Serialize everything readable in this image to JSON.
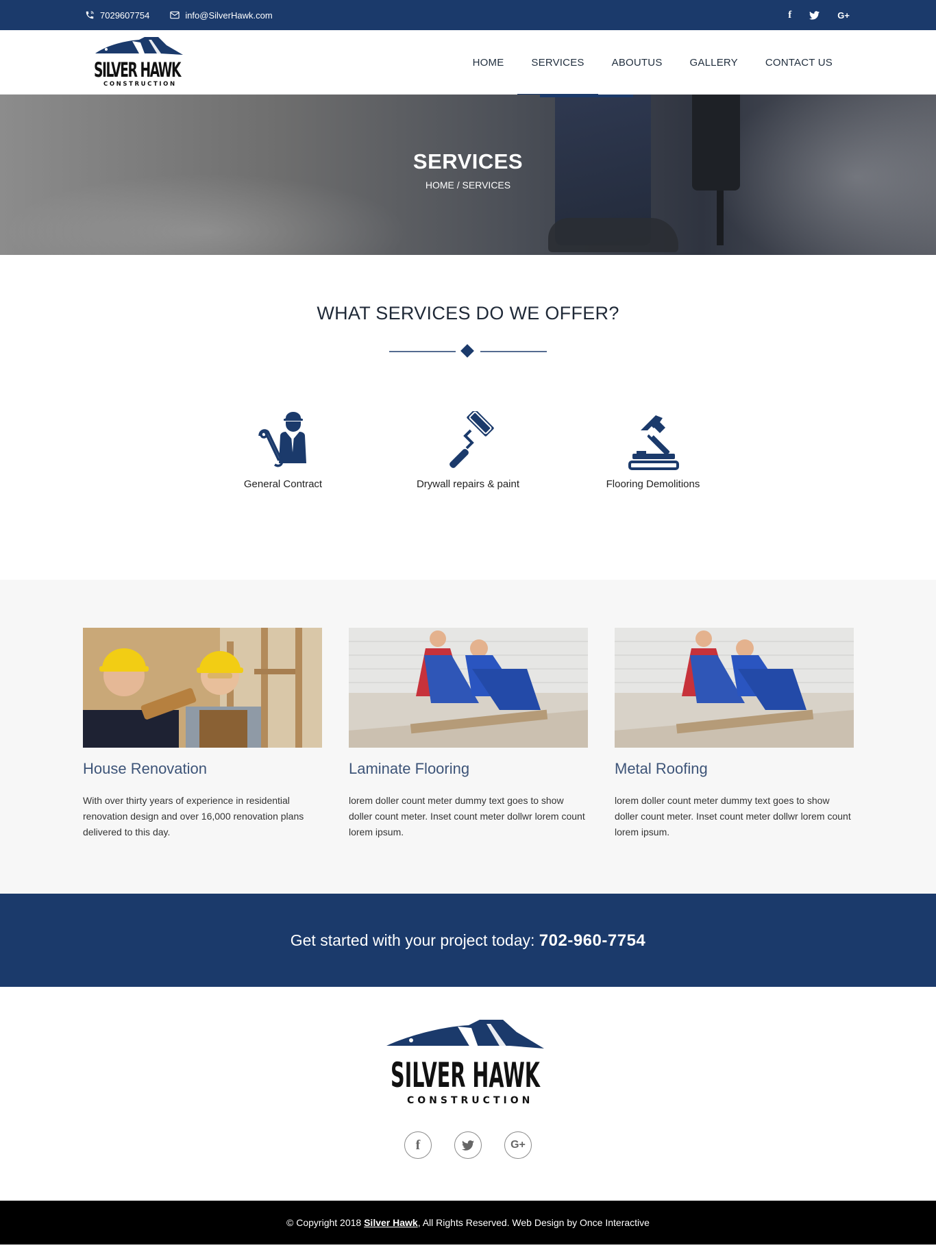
{
  "topbar": {
    "phone": "7029607754",
    "email": "info@SilverHawk.com",
    "social": {
      "facebook": "f",
      "twitter": "twitter-bird",
      "googleplus": "G+"
    }
  },
  "header": {
    "logo": {
      "name": "SILVER HAWK",
      "sub": "CONSTRUCTION"
    },
    "nav": [
      {
        "label": "HOME"
      },
      {
        "label": "SERVICES"
      },
      {
        "label": "ABOUTUS"
      },
      {
        "label": "GALLERY"
      },
      {
        "label": "CONTACT US"
      }
    ],
    "active": "SERVICES"
  },
  "hero": {
    "title": "SERVICES",
    "breadcrumb": "HOME / SERVICES"
  },
  "offer": {
    "title": "WHAT SERVICES DO WE OFFER?",
    "services": [
      {
        "label": "General Contract",
        "icon": "contractor-icon"
      },
      {
        "label": "Drywall repairs & paint",
        "icon": "paint-roller-icon"
      },
      {
        "label": "Flooring Demolitions",
        "icon": "hammer-icon"
      }
    ]
  },
  "cards": [
    {
      "title": "House Renovation",
      "text": "With over thirty years of experience in residential renovation design and over 16,000 renovation plans delivered to this day."
    },
    {
      "title": "Laminate Flooring",
      "text": "lorem doller count meter dummy text goes to show doller count meter. Inset count meter dollwr lorem count lorem ipsum."
    },
    {
      "title": "Metal Roofing",
      "text": "lorem doller count meter dummy text goes to show doller count meter. Inset count meter dollwr lorem count lorem ipsum."
    }
  ],
  "cta": {
    "text": "Get started with your project today:",
    "phone": "702-960-7754"
  },
  "footer": {
    "social": {
      "facebook": "f",
      "googleplus": "G+"
    },
    "copyright_prefix": "© Copyright 2018",
    "brand": "Silver Hawk",
    "copyright_suffix": ", All Rights Reserved. Web Design by Once Interactive"
  },
  "colors": {
    "brand": "#1b3a6b",
    "heading": "#3d5478",
    "section_bg": "#f7f7f7"
  }
}
